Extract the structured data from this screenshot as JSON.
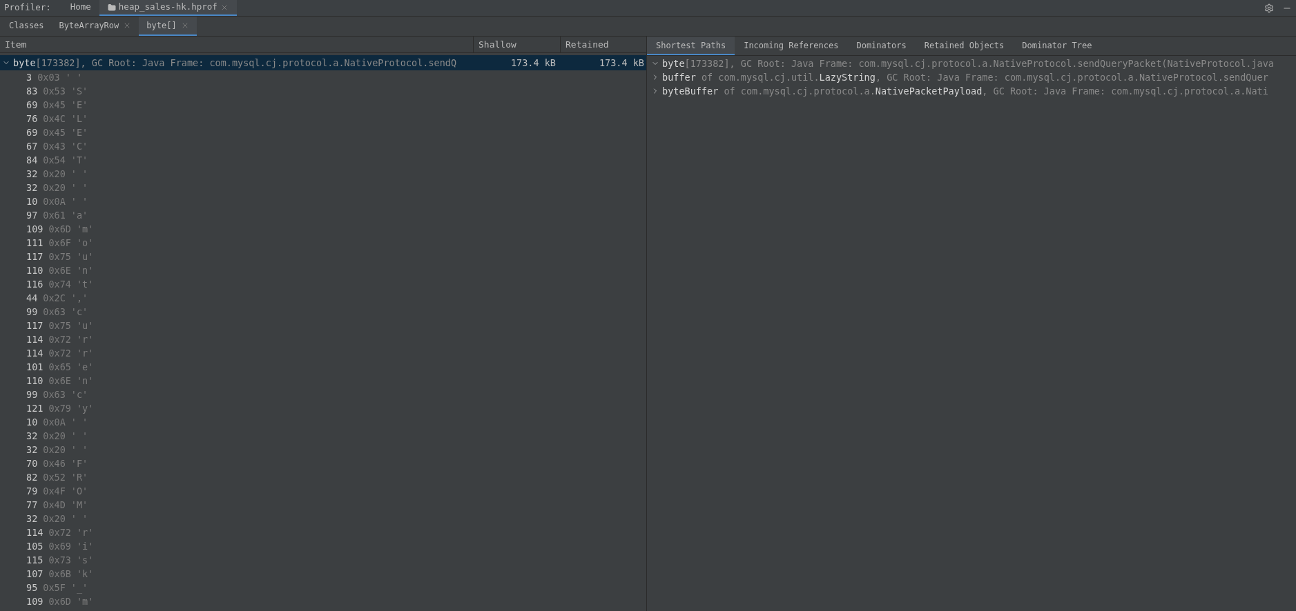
{
  "toolbar": {
    "label": "Profiler:",
    "tabs": [
      {
        "label": "Home",
        "selected": false,
        "kind": "plain",
        "closable": false
      },
      {
        "label": "heap_sales-hk.hprof",
        "selected": true,
        "kind": "file",
        "closable": true
      }
    ]
  },
  "subtabs": [
    {
      "label": "Classes",
      "selected": false,
      "closable": false
    },
    {
      "label": "ByteArrayRow",
      "selected": false,
      "closable": true
    },
    {
      "label": "byte[]",
      "selected": true,
      "closable": true
    }
  ],
  "table": {
    "columns": [
      "Item",
      "Shallow",
      "Retained"
    ],
    "root": {
      "name": "byte",
      "detail": "[173382], GC Root: Java Frame: com.mysql.cj.protocol.a.NativeProtocol.sendQ",
      "shallow": "173.4 kB",
      "retained": "173.4 kB",
      "selected": true,
      "expanded": true,
      "children": [
        {
          "value": "3",
          "hex": "0x03",
          "char": "' '"
        },
        {
          "value": "83",
          "hex": "0x53",
          "char": "'S'"
        },
        {
          "value": "69",
          "hex": "0x45",
          "char": "'E'"
        },
        {
          "value": "76",
          "hex": "0x4C",
          "char": "'L'"
        },
        {
          "value": "69",
          "hex": "0x45",
          "char": "'E'"
        },
        {
          "value": "67",
          "hex": "0x43",
          "char": "'C'"
        },
        {
          "value": "84",
          "hex": "0x54",
          "char": "'T'"
        },
        {
          "value": "32",
          "hex": "0x20",
          "char": "' '"
        },
        {
          "value": "32",
          "hex": "0x20",
          "char": "' '"
        },
        {
          "value": "10",
          "hex": "0x0A",
          "char": "' '"
        },
        {
          "value": "97",
          "hex": "0x61",
          "char": "'a'"
        },
        {
          "value": "109",
          "hex": "0x6D",
          "char": "'m'"
        },
        {
          "value": "111",
          "hex": "0x6F",
          "char": "'o'"
        },
        {
          "value": "117",
          "hex": "0x75",
          "char": "'u'"
        },
        {
          "value": "110",
          "hex": "0x6E",
          "char": "'n'"
        },
        {
          "value": "116",
          "hex": "0x74",
          "char": "'t'"
        },
        {
          "value": "44",
          "hex": "0x2C",
          "char": "','"
        },
        {
          "value": "99",
          "hex": "0x63",
          "char": "'c'"
        },
        {
          "value": "117",
          "hex": "0x75",
          "char": "'u'"
        },
        {
          "value": "114",
          "hex": "0x72",
          "char": "'r'"
        },
        {
          "value": "114",
          "hex": "0x72",
          "char": "'r'"
        },
        {
          "value": "101",
          "hex": "0x65",
          "char": "'e'"
        },
        {
          "value": "110",
          "hex": "0x6E",
          "char": "'n'"
        },
        {
          "value": "99",
          "hex": "0x63",
          "char": "'c'"
        },
        {
          "value": "121",
          "hex": "0x79",
          "char": "'y'"
        },
        {
          "value": "10",
          "hex": "0x0A",
          "char": "' '"
        },
        {
          "value": "32",
          "hex": "0x20",
          "char": "' '"
        },
        {
          "value": "32",
          "hex": "0x20",
          "char": "' '"
        },
        {
          "value": "70",
          "hex": "0x46",
          "char": "'F'"
        },
        {
          "value": "82",
          "hex": "0x52",
          "char": "'R'"
        },
        {
          "value": "79",
          "hex": "0x4F",
          "char": "'O'"
        },
        {
          "value": "77",
          "hex": "0x4D",
          "char": "'M'"
        },
        {
          "value": "32",
          "hex": "0x20",
          "char": "' '"
        },
        {
          "value": "114",
          "hex": "0x72",
          "char": "'r'"
        },
        {
          "value": "105",
          "hex": "0x69",
          "char": "'i'"
        },
        {
          "value": "115",
          "hex": "0x73",
          "char": "'s'"
        },
        {
          "value": "107",
          "hex": "0x6B",
          "char": "'k'"
        },
        {
          "value": "95",
          "hex": "0x5F",
          "char": "'_'"
        },
        {
          "value": "109",
          "hex": "0x6D",
          "char": "'m'"
        }
      ]
    }
  },
  "details": {
    "tabs": [
      {
        "label": "Shortest Paths",
        "selected": true
      },
      {
        "label": "Incoming References",
        "selected": false
      },
      {
        "label": "Dominators",
        "selected": false
      },
      {
        "label": "Retained Objects",
        "selected": false
      },
      {
        "label": "Dominator Tree",
        "selected": false
      }
    ],
    "paths": [
      {
        "expanded": true,
        "segments": [
          {
            "text": "byte",
            "emphasis": true
          },
          {
            "text": "[173382], GC Root: Java Frame: com.mysql.cj.protocol.a.NativeProtocol.sendQueryPacket(NativeProtocol.java",
            "emphasis": false
          }
        ]
      },
      {
        "expanded": false,
        "segments": [
          {
            "text": "buffer",
            "emphasis": true
          },
          {
            "text": " of com.mysql.cj.util.",
            "emphasis": false
          },
          {
            "text": "LazyString",
            "emphasis": true
          },
          {
            "text": ", GC Root: Java Frame: com.mysql.cj.protocol.a.NativeProtocol.sendQuer",
            "emphasis": false
          }
        ]
      },
      {
        "expanded": false,
        "segments": [
          {
            "text": "byteBuffer",
            "emphasis": true
          },
          {
            "text": " of com.mysql.cj.protocol.a.",
            "emphasis": false
          },
          {
            "text": "NativePacketPayload",
            "emphasis": true
          },
          {
            "text": ", GC Root: Java Frame: com.mysql.cj.protocol.a.Nati",
            "emphasis": false
          }
        ]
      }
    ]
  }
}
